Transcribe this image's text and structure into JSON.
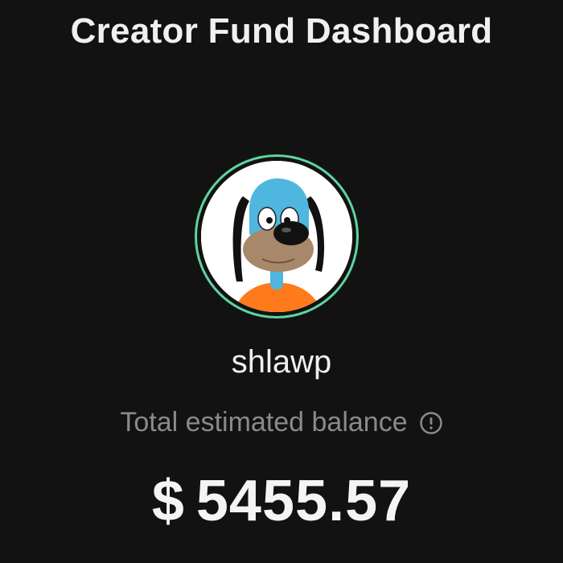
{
  "header": {
    "title": "Creator Fund Dashboard"
  },
  "profile": {
    "username": "shlawp",
    "avatar_ring_color": "#5fd3a0"
  },
  "balance": {
    "label": "Total estimated balance",
    "info_icon": "info-circle-icon",
    "currency_symbol": "$",
    "amount": "5455.57"
  },
  "colors": {
    "background": "#121212",
    "text_primary": "#f2f2f2",
    "text_secondary": "#8a8a8a"
  }
}
